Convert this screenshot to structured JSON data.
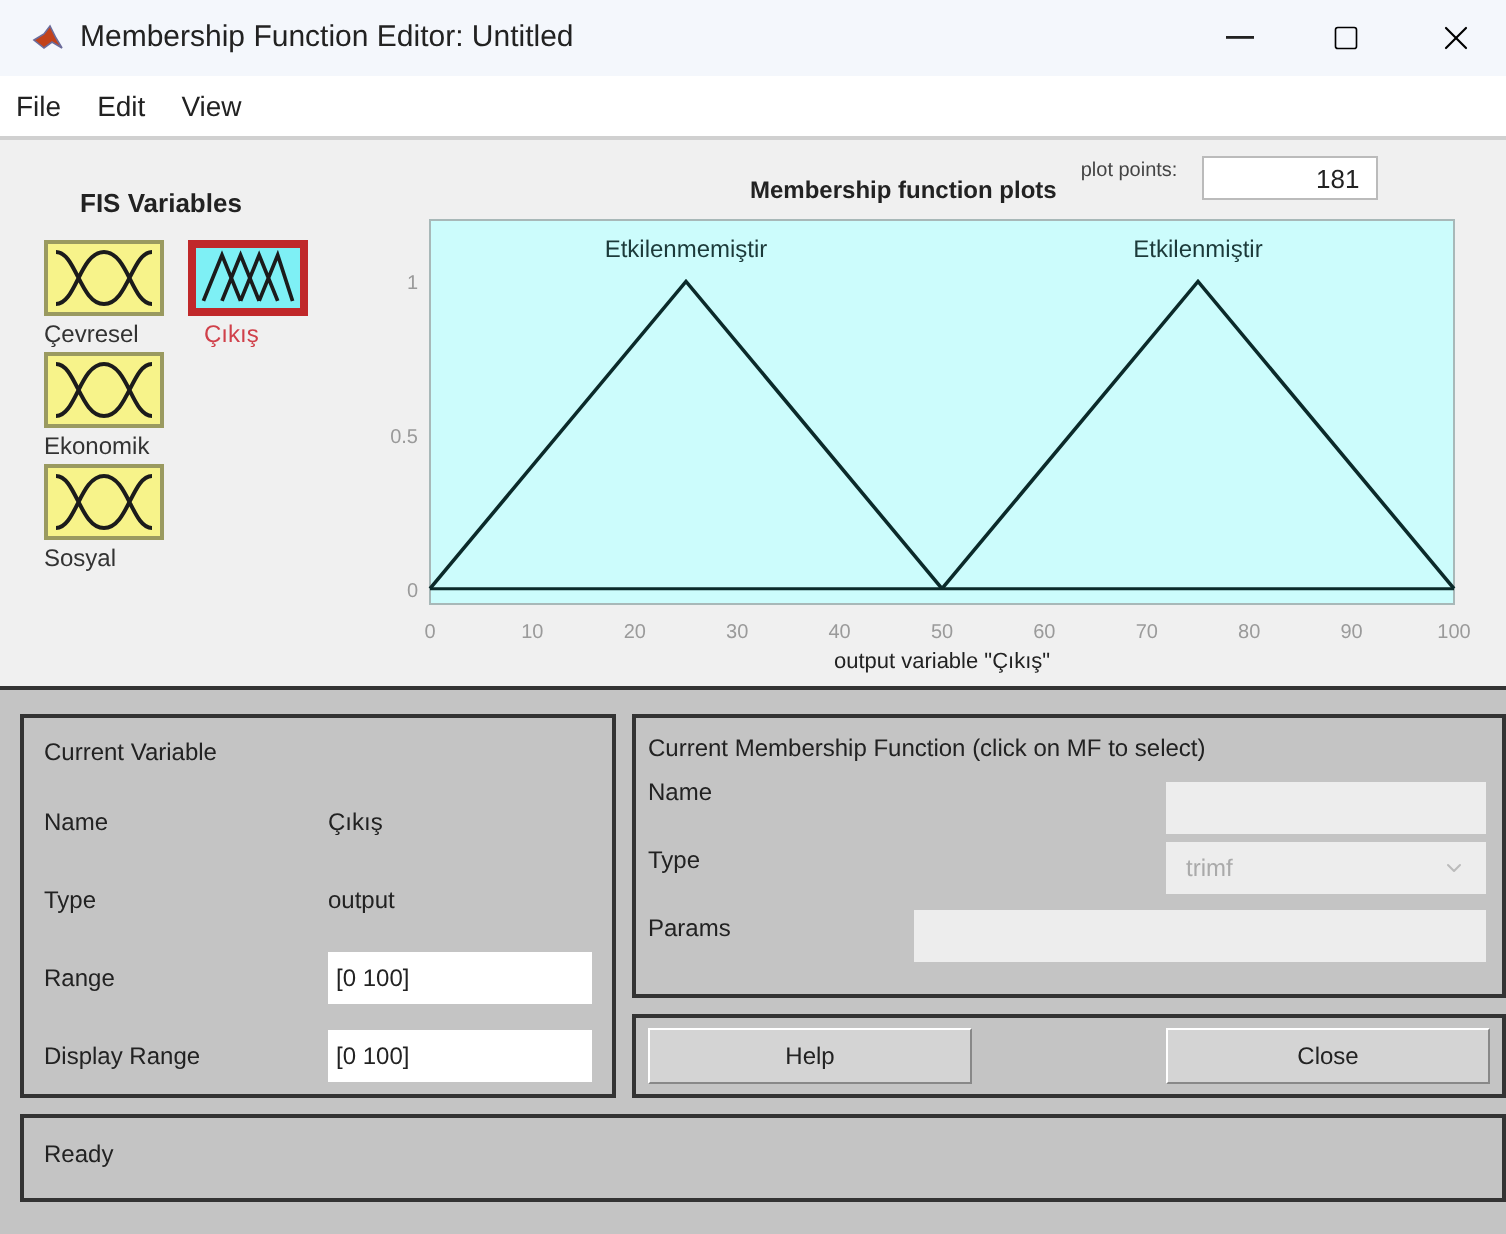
{
  "window": {
    "title": "Membership Function Editor: Untitled"
  },
  "menu": [
    "File",
    "Edit",
    "View"
  ],
  "fis_variables": {
    "title": "FIS Variables",
    "items": [
      {
        "name": "Çevresel",
        "kind": "input",
        "selected": false
      },
      {
        "name": "Çıkış",
        "kind": "output",
        "selected": true
      },
      {
        "name": "Ekonomik",
        "kind": "input",
        "selected": false
      },
      {
        "name": "Sosyal",
        "kind": "input",
        "selected": false
      }
    ]
  },
  "plot": {
    "plot_points_label": "plot points:",
    "plot_points": "181",
    "chart_data": {
      "type": "line",
      "title": "Membership function plots",
      "xlabel": "output variable \"Çıkış\"",
      "x": [
        0,
        25,
        50,
        75,
        100
      ],
      "series": [
        {
          "name": "Etkilenmemiştir",
          "color": "#0b2a2a",
          "values": [
            0,
            1,
            0,
            null,
            null
          ]
        },
        {
          "name": "Etkilenmiştir",
          "color": "#0b2a2a",
          "values": [
            null,
            null,
            0,
            1,
            0
          ]
        }
      ],
      "xlim": [
        0,
        100
      ],
      "ylim": [
        -0.05,
        1.2
      ],
      "xticks": [
        0,
        10,
        20,
        30,
        40,
        50,
        60,
        70,
        80,
        90,
        100
      ],
      "yticks": [
        0,
        0.5,
        1
      ]
    }
  },
  "current_variable": {
    "title": "Current Variable",
    "rows": [
      {
        "label": "Name",
        "kind": "text",
        "value": "Çıkış"
      },
      {
        "label": "Type",
        "kind": "text",
        "value": "output"
      },
      {
        "label": "Range",
        "kind": "field",
        "value": "[0 100]"
      },
      {
        "label": "Display Range",
        "kind": "field",
        "value": "[0 100]"
      }
    ]
  },
  "current_mf": {
    "title": "Current Membership Function (click on MF to select)",
    "name_label": "Name",
    "type_label": "Type",
    "type_value": "trimf",
    "type_disabled": true,
    "params_label": "Params"
  },
  "buttons": [
    "Help",
    "Close"
  ],
  "status_bar": "Ready"
}
